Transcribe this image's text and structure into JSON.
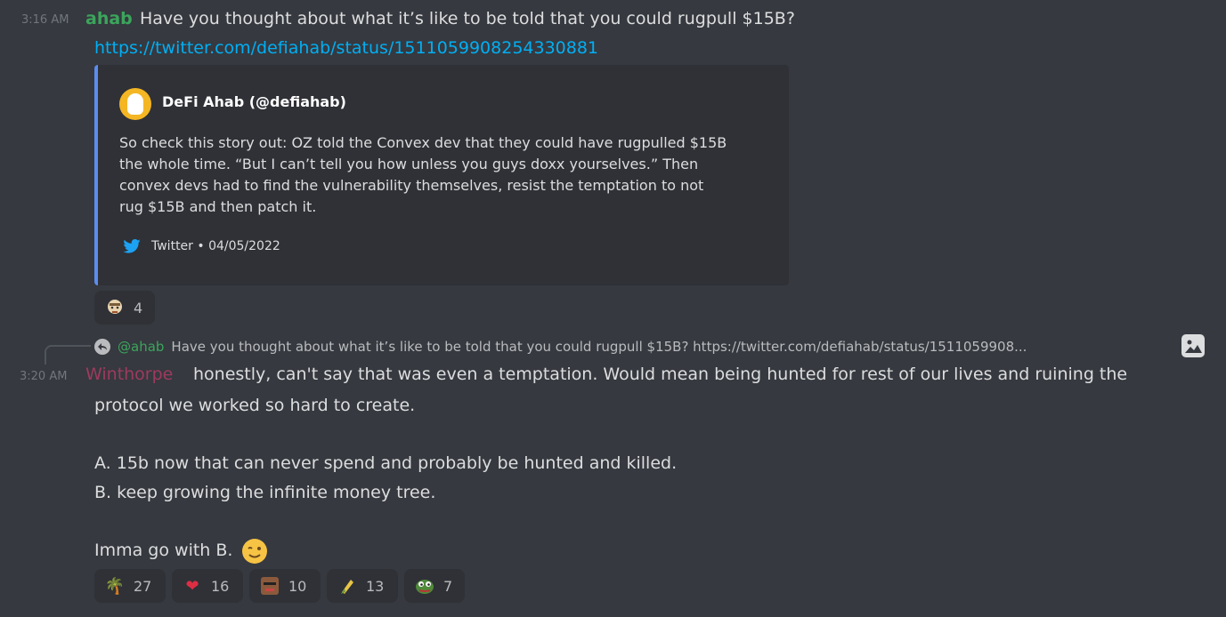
{
  "message1": {
    "timestamp": "3:16 AM",
    "author": "ahab",
    "author_color": "#3ba55c",
    "text": "Have you thought about what it’s like to be told that you could rugpull $15B?",
    "link": "https://twitter.com/defiahab/status/1511059908254330881",
    "embed": {
      "accent_color": "#5b8def",
      "author": "DeFi Ahab (@defiahab)",
      "description": "So check this story out: OZ told the Convex dev that they could have rugpulled $15B\nthe whole time. “But I can’t tell you how unless you guys doxx yourselves.” Then\nconvex devs had to find the vulnerability themselves, resist the temptation to not\nrug $15B and then patch it.",
      "footer": "Twitter • 04/05/2022",
      "footer_icon": "twitter-icon"
    },
    "reactions": [
      {
        "emoji": "custom-face-icon",
        "count": "4"
      }
    ]
  },
  "message2": {
    "reply_to": {
      "author": "@ahab",
      "text": "Have you thought about what it’s like to be told that you could rugpull $15B? https://twitter.com/defiahab/status/1511059908..."
    },
    "timestamp": "3:20 AM",
    "author": "Winthorpe",
    "author_color": "#9e3a5f",
    "line1": "honestly, can't say that was even a temptation. Would mean being hunted for rest of our lives and ruining the",
    "line2": "protocol we worked so hard to create.",
    "line3": "A. 15b now that can never spend and probably be hunted and killed.",
    "line4": "B.  keep growing the infinite money tree.",
    "line5": "Imma go with B.",
    "reactions": [
      {
        "emoji": "palm-tree-icon",
        "glyph": "🌴",
        "count": "27"
      },
      {
        "emoji": "heart-icon",
        "glyph": "❤",
        "count": "16"
      },
      {
        "emoji": "custom-face-icon",
        "count": "10"
      },
      {
        "emoji": "custom-corn-icon",
        "count": "13"
      },
      {
        "emoji": "pepe-icon",
        "count": "7"
      }
    ]
  }
}
